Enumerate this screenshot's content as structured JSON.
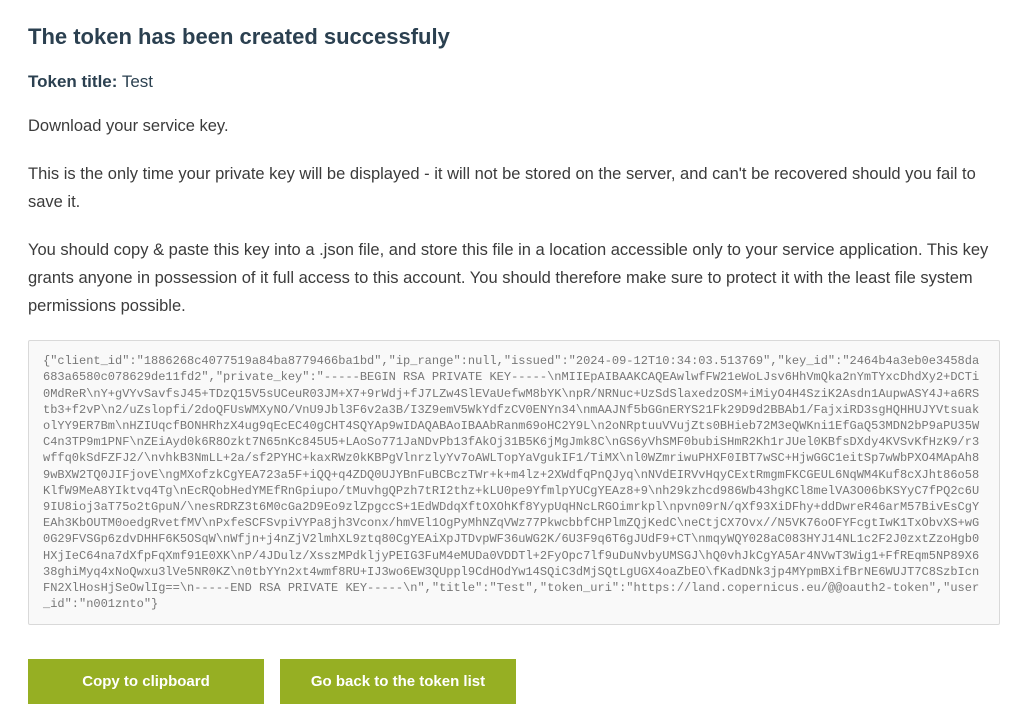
{
  "heading": "The token has been created successfuly",
  "token_title": {
    "label": "Token title:",
    "value": "Test"
  },
  "paragraphs": {
    "download": "Download your service key.",
    "warning": "This is the only time your private key will be displayed - it will not be stored on the server, and can't be recovered should you fail to save it.",
    "instructions": "You should copy & paste this key into a .json file, and store this file in a location accessible only to your service application. This key grants anyone in possession of it full access to this account. You should therefore make sure to protect it with the least file system permissions possible."
  },
  "service_key": "{\"client_id\":\"1886268c4077519a84ba8779466ba1bd\",\"ip_range\":null,\"issued\":\"2024-09-12T10:34:03.513769\",\"key_id\":\"2464b4a3eb0e3458da683a6580c078629de11fd2\",\"private_key\":\"-----BEGIN RSA PRIVATE KEY-----\\nMIIEpAIBAAKCAQEAwlwfFW21eWoLJsv6HhVmQka2nYmTYxcDhdXy2+DCTi0MdReR\\nY+gVYvSavfsJ45+TDzQ15V5sUCeuR03JM+X7+9rWdj+fJ7LZw4SlEVaUefwM8bYK\\npR/NRNuc+UzSdSlaxedzOSM+iMiyO4H4SziK2Asdn1AupwASY4J+a6RStb3+f2vP\\n2/uZslopfi/2doQFUsWMXyNO/VnU9Jbl3F6v2a3B/I3Z9emV5WkYdfzCV0ENYn34\\nmAAJNf5bGGnERYS21Fk29D9d2BBAb1/FajxiRD3sgHQHHUJYVtsuakolYY9ER7Bm\\nHZIUqcfBONHRhzX4ug9qEcEC40gCHT4SQYAp9wIDAQABAoIBAAbRanm69oHC2Y9L\\n2oNRptuuVVujZts0BHieb72M3eQWKni1EfGaQ53MDN2bP9aPU35WC4n3TP9m1PNF\\nZEiAyd0k6R8Ozkt7N65nKc845U5+LAoSo771JaNDvPb13fAkOj31B5K6jMgJmk8C\\nGS6yVhSMF0bubiSHmR2Kh1rJUel0KBfsDXdy4KVSvKfHzK9/r3wffq0kSdFZFJ2/\\nvhkB3NmLL+2a/sf2PYHC+kaxRWz0kKBPgVlnrzlyYv7oAWLTopYaVgukIF1/TiMX\\nl0WZmriwuPHXF0IBT7wSC+HjwGGC1eitSp7wWbPXO4MApAh89wBXW2TQ0JIFjovE\\ngMXofzkCgYEA723a5F+iQQ+q4ZDQ0UJYBnFuBCBczTWr+k+m4lz+2XWdfqPnQJyq\\nNVdEIRVvHqyCExtRmgmFKCGEUL6NqWM4Kuf8cXJht86o58KlfW9MeA8YIktvq4Tg\\nEcRQobHedYMEfRnGpiupo/tMuvhgQPzh7tRI2thz+kLU0pe9YfmlpYUCgYEAz8+9\\nh29kzhcd986Wb43hgKCl8melVA3O06bKSYyC7fPQ2c6U9IU8ioj3aT75o2tGpuN/\\nesRDRZ3t6M0cGa2D9Eo9zlZpgccS+1EdWDdqXftOXOhKf8YypUqHNcLRGOimrkpl\\npvn09rN/qXf93XiDFhy+ddDwreR46arM57BivEsCgYEAh3KbOUTM0oedgRvetfMV\\nPxfeSCFSvpiVYPa8jh3Vconx/hmVEl1OgPyMhNZqVWz77PkwcbbfCHPlmZQjKedC\\neCtjCX7Ovx//N5VK76oOFYFcgtIwK1TxObvXS+wG0G29FVSGp6zdvDHHF6K5OSqW\\nWfjn+j4nZjV2lmhXL9ztq80CgYEAiXpJTDvpWF36uWG2K/6U3F9q6T6gJUdF9+CT\\nmqyWQY028aC083HYJ14NL1c2F2J0zxtZzoHgb0HXjIeC64na7dXfpFqXmf91E0XK\\nP/4JDulz/XsszMPdkljyPEIG3FuM4eMUDa0VDDTl+2FyOpc7lf9uDuNvbyUMSGJ\\hQ0vhJkCgYA5Ar4NVwT3Wig1+FfREqm5NP89X638ghiMyq4xNoQwxu3lVe5NR0KZ\\n0tbYYn2xt4wmf8RU+IJ3wo6EW3QUppl9CdHOdYw14SQiC3dMjSQtLgUGX4oaZbEO\\fKadDNk3jp4MYpmBXifBrNE6WUJT7C8SzbIcnFN2XlHosHjSeOwlIg==\\n-----END RSA PRIVATE KEY-----\\n\",\"title\":\"Test\",\"token_uri\":\"https://land.copernicus.eu/@@oauth2-token\",\"user_id\":\"n001znto\"}",
  "buttons": {
    "copy": "Copy to clipboard",
    "back": "Go back to the token list"
  }
}
